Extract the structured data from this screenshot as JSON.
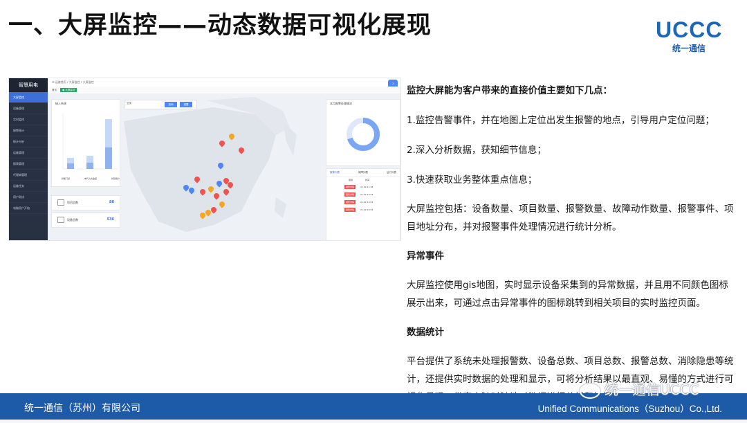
{
  "slide": {
    "title": "一、大屏监控——动态数据可视化展现",
    "logo_word": "UCCC",
    "logo_sub": "统一通信"
  },
  "dashboard": {
    "brand": "智慧用电",
    "sidebar_items": [
      "大屏监控",
      "设备管理",
      "实时监控",
      "报警统计",
      "统计分析",
      "运维管理",
      "报表管理",
      "代理商管理",
      "运维任务",
      "用户测试",
      "电脑用户开始"
    ],
    "breadcrumb": "运维首页 / 大屏监控 / 大屏监控",
    "tab_home": "首页",
    "tab_active": "● 大屏监控",
    "left_panel_title": "接入系统",
    "bar_labels": [
      "智能门禁",
      "电气火灾监控",
      "智慧用户"
    ],
    "stat_project_label": "项目总数",
    "stat_project_value": "88",
    "stat_device_label": "设备总数",
    "stat_device_value": "536",
    "search_placeholder": "全国",
    "btn_search": "查询",
    "btn_reset": "重置",
    "right_panel_title": "本月报警处理情况",
    "tabs_alarm": [
      "报警列表",
      "故障列表",
      "运行列表"
    ],
    "alarm_cols": [
      "级别",
      "时间"
    ],
    "alarm_tags": [
      "报警详情",
      "报警详情",
      "报警详情",
      "报警详情"
    ],
    "alarm_times": [
      "21-02 11:18",
      "21-02 10:54",
      "21-02 10:54",
      "21-02 10:54"
    ],
    "donut_fill": 0.7
  },
  "content": {
    "heading1": "监控大屏能为客户带来的直接价值主要如下几点：",
    "point1": "1.监控告警事件，并在地图上定位出发生报警的地点，引导用户定位问题；",
    "point2": "2.深入分析数据，获知细节信息；",
    "point3": "3.快速获取业务整体重点信息；",
    "para1": "大屏监控包括：设备数量、项目数量、报警数量、故障动作数量、报警事件、项目地址分布，并对报警事件处理情况进行统计分析。",
    "heading2": "异常事件",
    "para2": "大屏监控使用gis地图，实时显示设备采集到的异常数据，并且用不同颜色图标展示出来，可通过点击异常事件的图标跳转到相关项目的实时监控页面。",
    "heading3": "数据统计",
    "para3": "平台提供了系统未处理报警数、设备总数、项目总数、报警总数、消除隐患等统计，还提供实时数据的处理和显示，可将分析结果以最直观、易懂的方式进行可视化呈现，供客户随时随地对数据进行分析和挖掘。"
  },
  "footer": {
    "left": "统一通信（苏州）有限公司",
    "right": "Unified Communications（Suzhou）Co.,Ltd."
  },
  "watermark": "统一通信UCCC",
  "colors": {
    "footer_bg": "#1d5aa8",
    "accent": "#1e66b6",
    "dash_sidebar": "#273142"
  }
}
